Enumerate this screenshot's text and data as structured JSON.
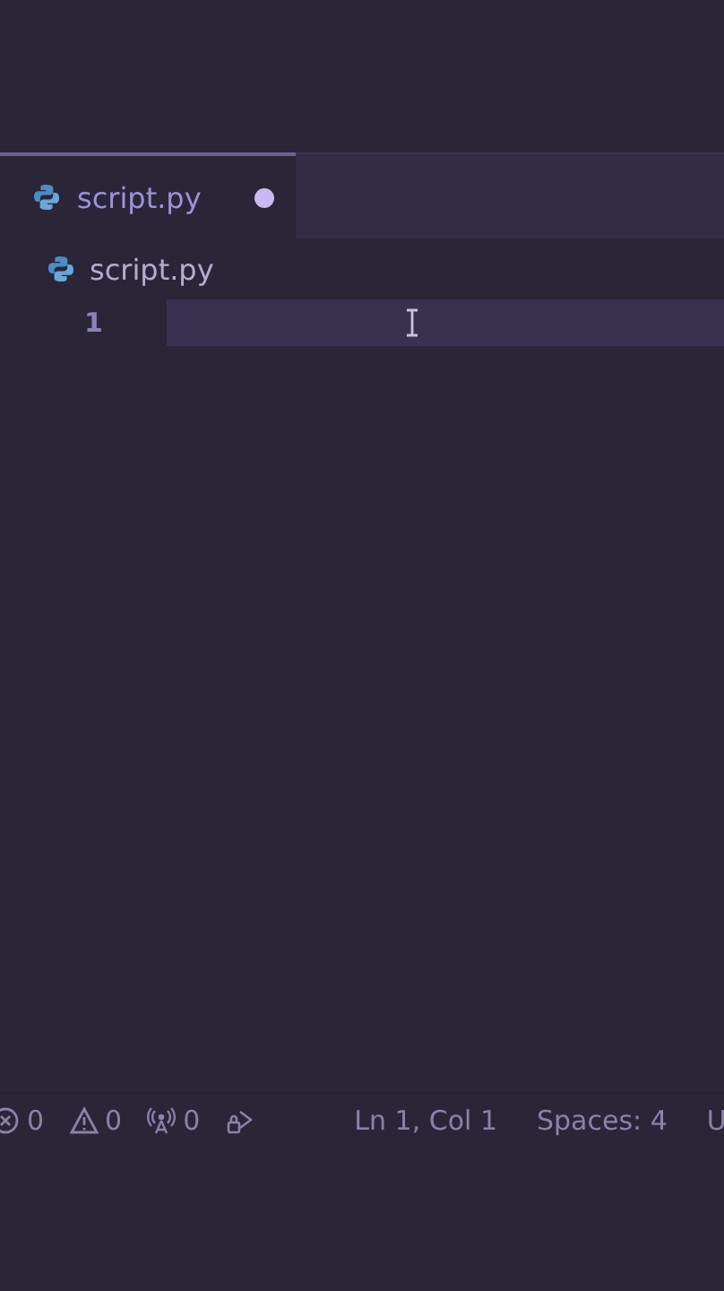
{
  "tabs": [
    {
      "label": "script.py",
      "selected": true,
      "modified": true
    }
  ],
  "breadcrumb": [
    {
      "label": "script.py"
    }
  ],
  "editor": {
    "lines": [
      {
        "number": "1",
        "current": true
      }
    ]
  },
  "status_bar": {
    "items": [
      {
        "kind": "errors",
        "text": "0"
      },
      {
        "kind": "warnings",
        "text": "0"
      },
      {
        "kind": "ports",
        "text": "0"
      },
      {
        "kind": "share"
      },
      {
        "kind": "text",
        "text": "Ln 1, Col 1"
      },
      {
        "kind": "text",
        "text": "Spaces: 4"
      },
      {
        "kind": "text",
        "text": "U"
      }
    ]
  }
}
